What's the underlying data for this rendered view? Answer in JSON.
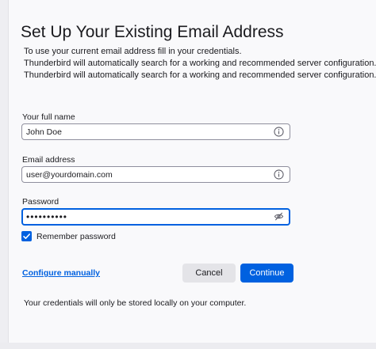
{
  "header": {
    "title": "Set Up Your Existing Email Address",
    "description_lines": [
      "To use your current email address fill in your credentials.",
      "Thunderbird will automatically search for a working and recommended server configuration.",
      "Thunderbird will automatically search for a working and recommended server configuration."
    ]
  },
  "form": {
    "full_name": {
      "label": "Your full name",
      "value": "John Doe",
      "icon": "info-icon"
    },
    "email": {
      "label": "Email address",
      "value": "user@yourdomain.com",
      "icon": "info-icon"
    },
    "password": {
      "label": "Password",
      "value": "••••••••••",
      "icon": "eye-slash-icon",
      "focused": true
    },
    "remember": {
      "label": "Remember password",
      "checked": true
    }
  },
  "actions": {
    "configure_manually": "Configure manually",
    "cancel": "Cancel",
    "continue": "Continue"
  },
  "footer": {
    "note": "Your credentials will only be stored locally on your computer."
  },
  "colors": {
    "accent": "#0061e0",
    "background": "#f9f9fb",
    "button_secondary": "#e4e4e8",
    "field_border": "#8f8f9d"
  }
}
